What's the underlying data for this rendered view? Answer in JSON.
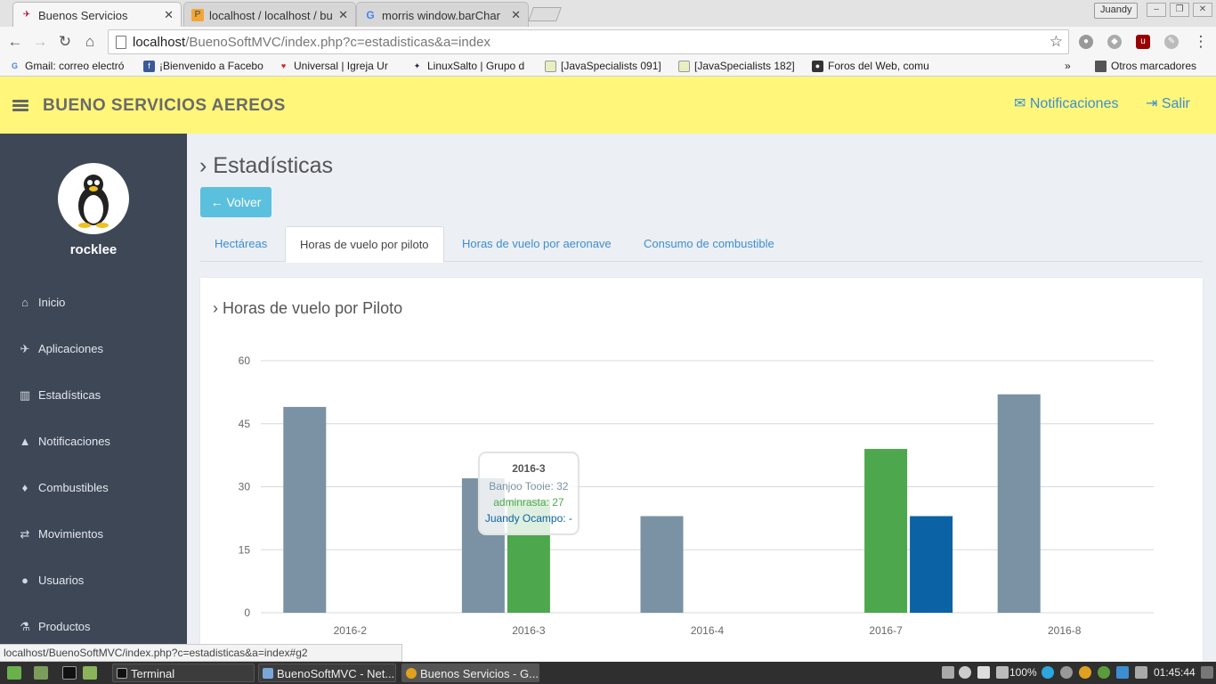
{
  "browser": {
    "tabs": [
      {
        "label": "Buenos Servicios",
        "active": true
      },
      {
        "label": "localhost / localhost / bu",
        "active": false
      },
      {
        "label": "morris window.barChar",
        "active": false
      }
    ],
    "user": "Juandy",
    "url_host": "localhost",
    "url_path": "/BuenoSoftMVC/index.php?c=estadisticas&a=index",
    "bookmarks": [
      "Gmail: correo electró",
      "¡Bienvenido a Facebo",
      "Universal | Igreja Ur",
      "LinuxSalto | Grupo d",
      "[JavaSpecialists 091]",
      "[JavaSpecialists 182]",
      "Foros del Web, comu"
    ],
    "bookmarks_more": "»",
    "bookmarks_other": "Otros marcadores",
    "status_url": "localhost/BuenoSoftMVC/index.php?c=estadisticas&a=index#g2"
  },
  "header": {
    "brand": "BUENO SERVICIOS AEREOS",
    "notifications": "Notificaciones",
    "logout": "Salir"
  },
  "sidebar": {
    "username": "rocklee",
    "items": [
      {
        "label": "Inicio",
        "icon": "home-icon"
      },
      {
        "label": "Aplicaciones",
        "icon": "plane-icon"
      },
      {
        "label": "Estadísticas",
        "icon": "bar-chart-icon"
      },
      {
        "label": "Notificaciones",
        "icon": "warning-icon"
      },
      {
        "label": "Combustibles",
        "icon": "tint-icon"
      },
      {
        "label": "Movimientos",
        "icon": "retweet-icon"
      },
      {
        "label": "Usuarios",
        "icon": "users-icon"
      },
      {
        "label": "Productos",
        "icon": "flask-icon"
      }
    ]
  },
  "main": {
    "title": "Estadísticas",
    "back_button": "Volver",
    "tabs": [
      {
        "label": "Hectáreas",
        "active": false
      },
      {
        "label": "Horas de vuelo por piloto",
        "active": true
      },
      {
        "label": "Horas de vuelo por aeronave",
        "active": false
      },
      {
        "label": "Consumo de combustible",
        "active": false
      }
    ],
    "panel_title": "Horas de vuelo por Piloto"
  },
  "chart_data": {
    "type": "bar",
    "categories": [
      "2016-2",
      "2016-3",
      "2016-4",
      "2016-7",
      "2016-8"
    ],
    "series": [
      {
        "name": "Banjoo Tooie",
        "color": "#7a92a3",
        "values": [
          49,
          32,
          23,
          null,
          52
        ]
      },
      {
        "name": "adminrasta",
        "color": "#4da74d",
        "values": [
          null,
          27,
          null,
          39,
          null
        ]
      },
      {
        "name": "Juandy Ocampo",
        "color": "#0b62a4",
        "values": [
          null,
          null,
          null,
          23,
          null
        ]
      }
    ],
    "yticks": [
      0,
      15,
      30,
      45,
      60
    ],
    "ylim": [
      0,
      60
    ],
    "grid": true,
    "tooltip": {
      "category": "2016-3",
      "lines": [
        "Banjoo Tooie: 32",
        "adminrasta: 27",
        "Juandy Ocampo: -"
      ]
    }
  },
  "taskbar": {
    "windows": [
      {
        "label": "Terminal",
        "active": false
      },
      {
        "label": "BuenoSoftMVC - Net...",
        "active": false
      },
      {
        "label": "Buenos Servicios - G...",
        "active": true
      }
    ],
    "battery": "100%",
    "clock": "01:45:44"
  }
}
